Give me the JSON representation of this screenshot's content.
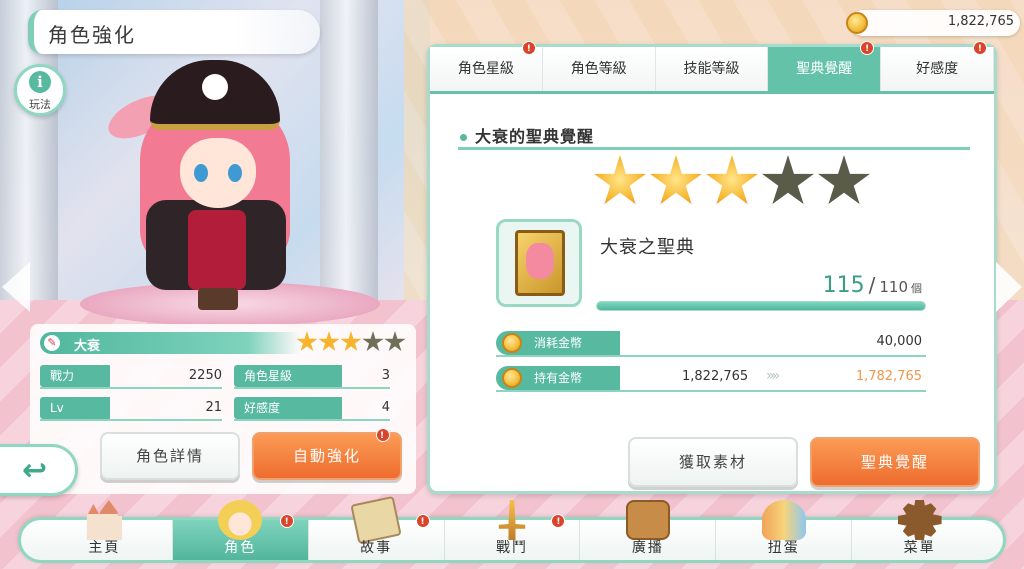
{
  "header": {
    "title": "角色強化",
    "help_label": "玩法",
    "help_icon": "i",
    "coins": "1,822,765"
  },
  "character": {
    "name": "大衰",
    "stars_filled": 3,
    "stars_total": 5,
    "stats": [
      {
        "label": "戰力",
        "value": "2250"
      },
      {
        "label": "角色星級",
        "value": "3"
      },
      {
        "label": "Lv",
        "value": "21"
      },
      {
        "label": "好感度",
        "value": "4"
      }
    ],
    "details_button": "角色詳情",
    "auto_button": "自動強化"
  },
  "tabs": [
    {
      "label": "角色星級",
      "badge": "!",
      "active": false
    },
    {
      "label": "角色等級",
      "badge": "",
      "active": false
    },
    {
      "label": "技能等級",
      "badge": "",
      "active": false
    },
    {
      "label": "聖典覺醒",
      "badge": "!",
      "active": true
    },
    {
      "label": "好感度",
      "badge": "!",
      "active": false
    }
  ],
  "awakening": {
    "title": "大衰的聖典覺醒",
    "stars_filled": 3,
    "stars_total": 5,
    "item_name": "大衰之聖典",
    "owned": "115",
    "separator": "/",
    "required": "110",
    "unit": "個",
    "progress_fraction": 1.0,
    "cost_label": "消耗金幣",
    "cost_value": "40,000",
    "held_label": "持有金幣",
    "held_value": "1,822,765",
    "held_after": "1,782,765",
    "get_material_button": "獲取素材",
    "awaken_button": "聖典覺醒"
  },
  "nav": [
    {
      "label": "主頁",
      "icon": "castle-icon",
      "badge": ""
    },
    {
      "label": "角色",
      "icon": "character-icon",
      "badge": "!",
      "active": true
    },
    {
      "label": "故事",
      "icon": "story-book-icon",
      "badge": "!"
    },
    {
      "label": "戰鬥",
      "icon": "sword-icon",
      "badge": "!"
    },
    {
      "label": "廣播",
      "icon": "radio-icon",
      "badge": ""
    },
    {
      "label": "扭蛋",
      "icon": "gacha-icon",
      "badge": ""
    },
    {
      "label": "菜單",
      "icon": "gear-icon",
      "badge": ""
    }
  ],
  "badge_text": "!",
  "back_icon": "↩",
  "colors": {
    "accent": "#57b9a0",
    "orange": "#ee6d2e",
    "star": "#f7b42c"
  }
}
